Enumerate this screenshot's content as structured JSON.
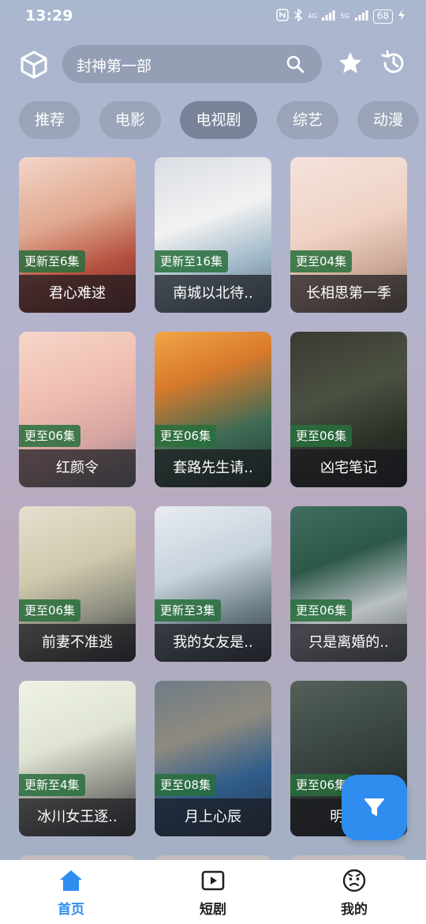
{
  "status_bar": {
    "time": "13:29",
    "network_labels": [
      "4G",
      "5G"
    ],
    "battery": "68"
  },
  "header": {
    "cube_icon": "cube-icon",
    "search": {
      "text": "封神第一部",
      "icon": "search-icon"
    },
    "favorites_icon": "star-icon",
    "history_icon": "history-icon"
  },
  "tabs": [
    {
      "label": "推荐"
    },
    {
      "label": "电影"
    },
    {
      "label": "电视剧",
      "active": true
    },
    {
      "label": "综艺"
    },
    {
      "label": "动漫"
    }
  ],
  "cards": [
    {
      "badge": "更新至6集",
      "title": "君心难逑"
    },
    {
      "badge": "更新至16集",
      "title": "南城以北待.."
    },
    {
      "badge": "更至04集",
      "title": "长相思第一季"
    },
    {
      "badge": "更至06集",
      "title": "红颜令"
    },
    {
      "badge": "更至06集",
      "title": "套路先生请.."
    },
    {
      "badge": "更至06集",
      "title": "凶宅笔记"
    },
    {
      "badge": "更至06集",
      "title": "前妻不准逃"
    },
    {
      "badge": "更新至3集",
      "title": "我的女友是.."
    },
    {
      "badge": "更至06集",
      "title": "只是离婚的.."
    },
    {
      "badge": "更新至4集",
      "title": "冰川女王逐.."
    },
    {
      "badge": "更至08集",
      "title": "月上心辰"
    },
    {
      "badge": "更至06集",
      "title": "明日.."
    }
  ],
  "fab": {
    "icon": "filter-icon",
    "color": "#2f8df0"
  },
  "bottom_nav": [
    {
      "label": "首页",
      "icon": "home-icon",
      "active": true
    },
    {
      "label": "短剧",
      "icon": "play-icon"
    },
    {
      "label": "我的",
      "icon": "profile-face-icon"
    }
  ],
  "colors": {
    "accent": "#2f8df0",
    "badge_green": "#286e3c"
  }
}
